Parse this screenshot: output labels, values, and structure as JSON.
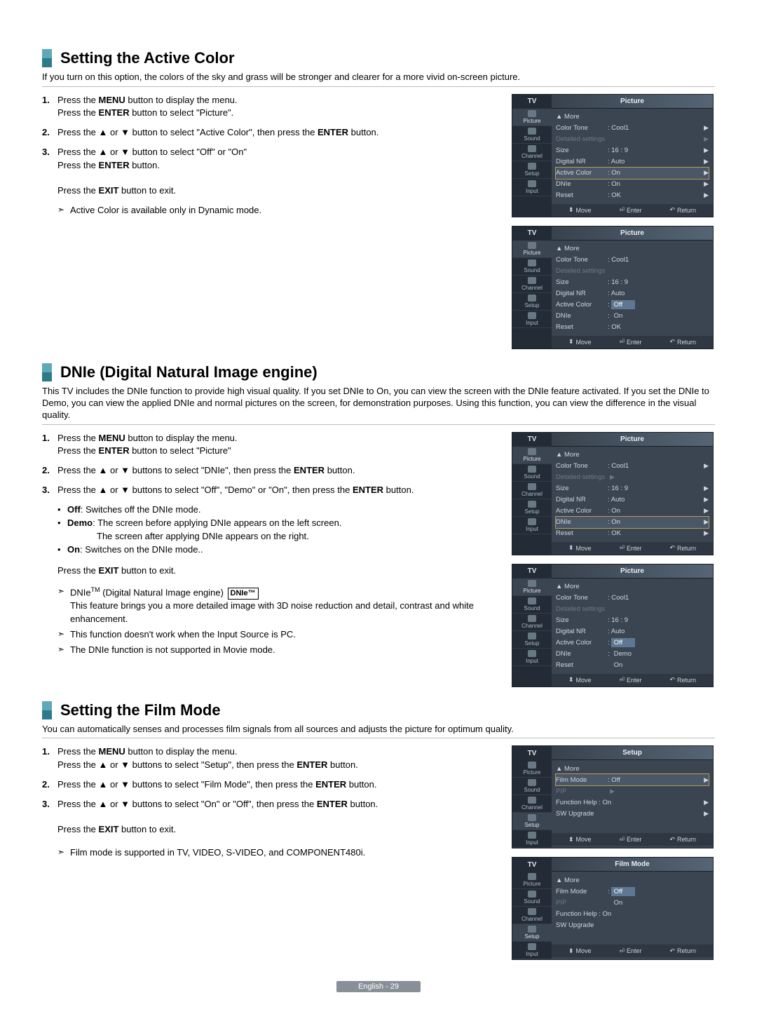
{
  "sections": {
    "activeColor": {
      "title": "Setting the Active Color",
      "intro": "If you turn on this option, the colors of the sky and grass will be stronger and clearer for a more vivid on-screen picture.",
      "step1a": "Press the ",
      "step1_menu": "MENU",
      "step1b": " button to display the menu.",
      "step1c": "Press the ",
      "step1_enter": "ENTER",
      "step1d": " button to select \"Picture\".",
      "step2a": "Press the ▲ or ▼ button to select \"Active Color\", then press the ",
      "step2_enter": "ENTER",
      "step2b": " button.",
      "step3a": "Press the ▲ or ▼ button to select \"Off\" or \"On\"",
      "step3b": "Press the ",
      "step3_enter": "ENTER",
      "step3c": " button.",
      "exit_a": "Press the ",
      "exit_b": "EXIT",
      "exit_c": " button to exit.",
      "note": "Active Color is available only in Dynamic  mode."
    },
    "dnie": {
      "title": "DNIe (Digital Natural Image engine)",
      "intro": "This TV includes the DNIe function to provide high visual quality. If you set DNIe to On, you can view the screen with the DNIe feature activated. If you set the DNIe to Demo, you can view the applied DNIe and normal pictures on the screen, for demonstration purposes. Using this function, you can view the difference in the visual quality.",
      "step1a": "Press the ",
      "step1_menu": "MENU",
      "step1b": " button to display the menu.",
      "step1c": "Press the ",
      "step1_enter": "ENTER",
      "step1d": " button to select \"Picture\"",
      "step2a": "Press the ▲ or ▼ buttons to select \"DNIe\", then press the ",
      "step2_enter": "ENTER",
      "step2b": " button.",
      "step3a": "Press the ▲ or ▼ buttons to select \"Off\", \"Demo\" or \"On\", then press the ",
      "step3_enter": "ENTER",
      "step3b": " button.",
      "b_off_l": "Off",
      "b_off": ": Switches off the DNIe mode.",
      "b_demo_l": "Demo",
      "b_demo": ": The screen before applying DNIe appears on the left screen.",
      "b_demo2": "The screen after applying DNIe appears on the right.",
      "b_on_l": "On",
      "b_on": ": Switches on the DNIe mode..",
      "exit_a": "Press the ",
      "exit_b": "EXIT",
      "exit_c": " button to exit.",
      "note1a": "DNIe",
      "note1b": " (Digital Natural Image engine) ",
      "note1box": "DNIe™",
      "note1c": "This feature brings you a more detailed image with 3D noise reduction and detail, contrast and white enhancement.",
      "note2": "This function doesn't work when the Input Source is PC.",
      "note3": "The DNIe function is not supported in Movie mode."
    },
    "film": {
      "title": "Setting the Film Mode",
      "intro": "You can automatically senses and processes film signals from all sources and adjusts the picture for optimum quality.",
      "step1a": "Press the ",
      "step1_menu": "MENU",
      "step1b": " button to display the menu.",
      "step1c": "Press the ▲ or ▼ buttons to select \"Setup\", then press the ",
      "step1_enter": "ENTER",
      "step1d": " button.",
      "step2a": "Press the ▲ or ▼ buttons to select \"Film Mode\", then press the ",
      "step2_enter": "ENTER",
      "step2b": " button.",
      "step3a": "Press the ▲ or ▼ buttons to select \"On\" or \"Off\", then press the ",
      "step3_enter": "ENTER",
      "step3b": " button.",
      "exit_a": "Press the ",
      "exit_b": "EXIT",
      "exit_c": " button to exit.",
      "note": "Film mode is supported in TV, VIDEO, S-VIDEO, and COMPONENT480i."
    }
  },
  "osd": {
    "tv": "TV",
    "sidebar": [
      "Picture",
      "Sound",
      "Channel",
      "Setup",
      "Input"
    ],
    "hdr_picture": "Picture",
    "hdr_setup": "Setup",
    "hdr_film": "Film Mode",
    "more": "▲ More",
    "colorTone": "Color Tone",
    "colorToneV": ": Cool1",
    "detailed": "Detailed settings",
    "size": "Size",
    "sizeV": ": 16 : 9",
    "digitalNR": "Digital NR",
    "digitalNRV": ": Auto",
    "activeColor": "Active Color",
    "activeColorV": ": On",
    "dnie": "DNIe",
    "dnieV": ": On",
    "reset": "Reset",
    "resetV": ": OK",
    "off": "Off",
    "on": "On",
    "demo": "Demo",
    "filmMode": "Film Mode",
    "filmModeV": ": Off",
    "pip": "PIP",
    "funcHelp": "Function Help : On",
    "swUpgrade": "SW Upgrade",
    "ft_move": "Move",
    "ft_enter": "Enter",
    "ft_return": "Return"
  },
  "footer": "English - 29"
}
